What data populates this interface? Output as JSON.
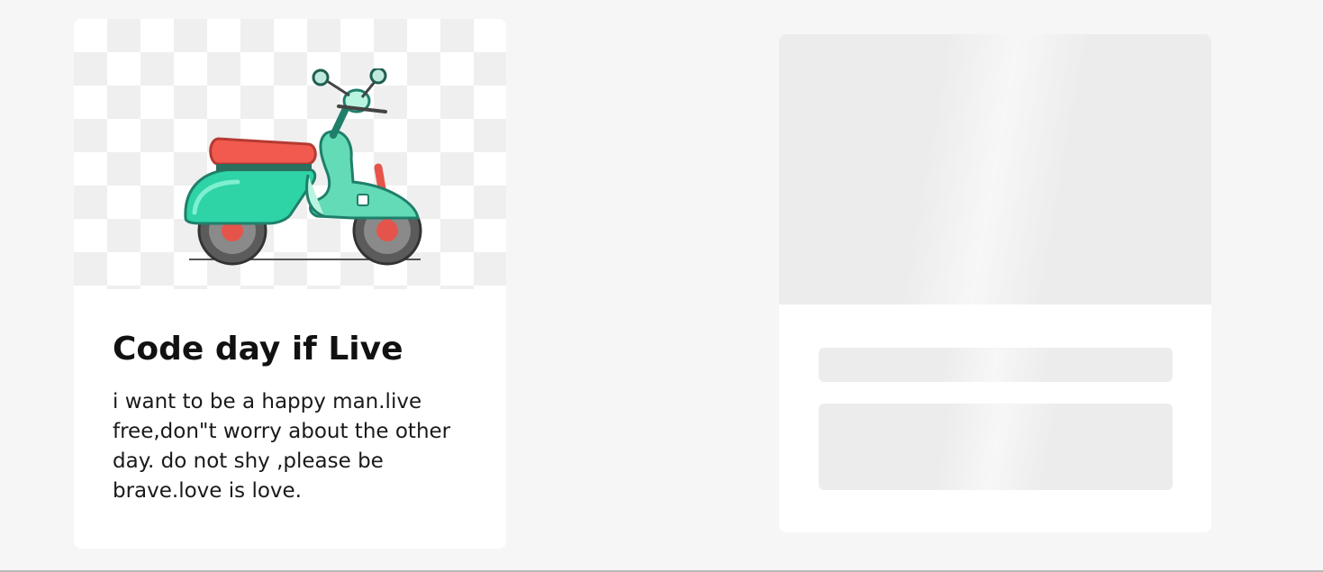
{
  "card": {
    "title": "Code day if Live",
    "description": "i want to be a happy man.live free,don\"t worry about the other day. do not shy ,please be brave.love is love.",
    "image_icon": "scooter-illustration"
  },
  "skeleton_card": {
    "state": "loading"
  },
  "colors": {
    "background": "#f6f6f6",
    "card": "#ffffff",
    "skeleton": "#ececec",
    "scooter_body": "#2ed3a6",
    "scooter_seat": "#f25a4f"
  }
}
